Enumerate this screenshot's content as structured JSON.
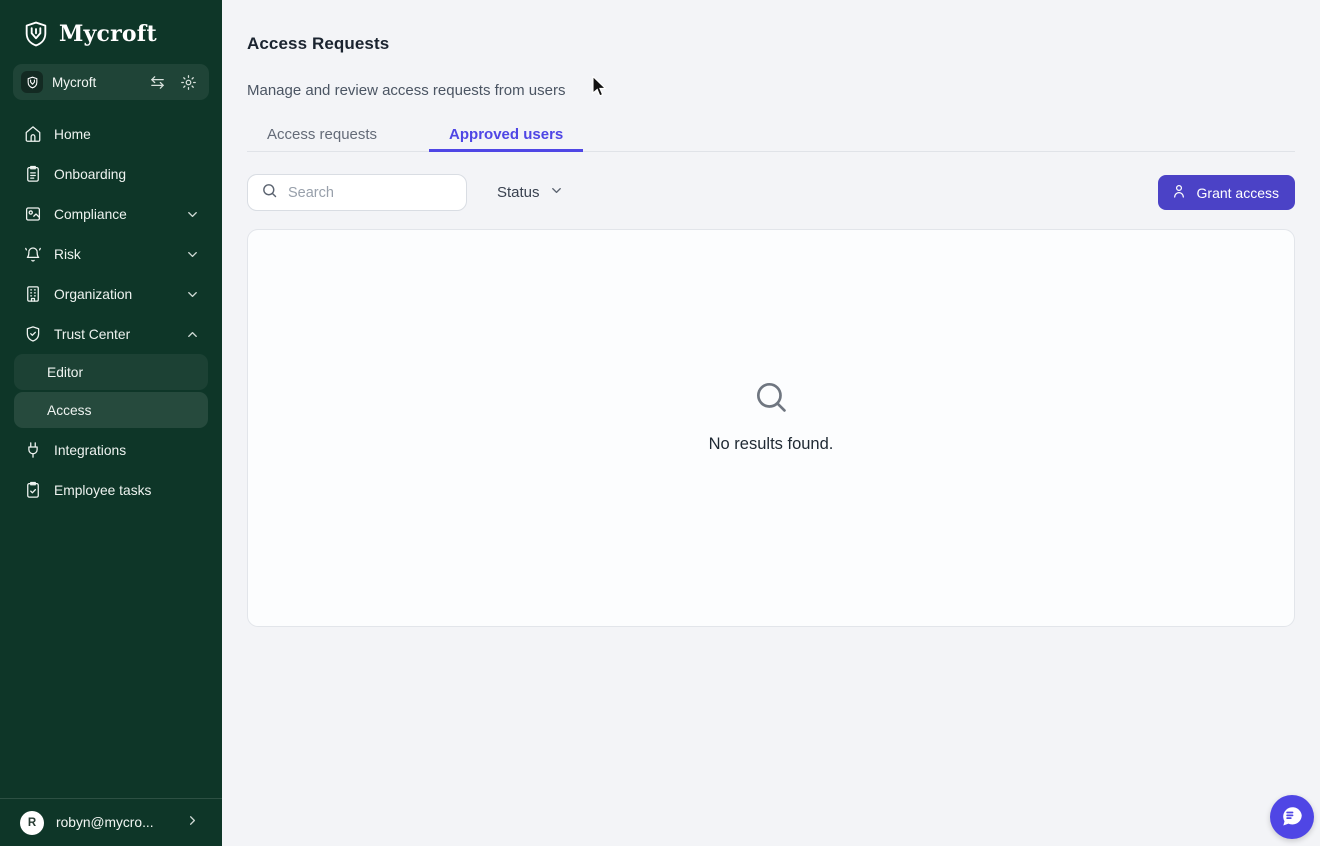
{
  "brand": {
    "logo_text": "Mycroft"
  },
  "workspace": {
    "name": "Mycroft"
  },
  "sidebar": {
    "items": [
      {
        "label": "Home"
      },
      {
        "label": "Onboarding"
      },
      {
        "label": "Compliance"
      },
      {
        "label": "Risk"
      },
      {
        "label": "Organization"
      },
      {
        "label": "Trust Center"
      },
      {
        "label": "Editor"
      },
      {
        "label": "Access"
      },
      {
        "label": "Integrations"
      },
      {
        "label": "Employee tasks"
      }
    ],
    "user": {
      "initial": "R",
      "email": "robyn@mycro..."
    }
  },
  "header": {
    "title": "Access Requests",
    "subtitle": "Manage and review access requests from users"
  },
  "tabs": [
    {
      "label": "Access requests",
      "active": false
    },
    {
      "label": "Approved users",
      "active": true
    }
  ],
  "controls": {
    "search_placeholder": "Search",
    "status_label": "Status",
    "grant_access_label": "Grant access"
  },
  "empty_state": {
    "message": "No results found."
  },
  "colors": {
    "sidebar_bg": "#0e3628",
    "main_bg": "#f3f4f7",
    "accent_indigo": "#4f46e5",
    "button_indigo": "#4b42c6",
    "card_border": "#e2e5ea"
  }
}
